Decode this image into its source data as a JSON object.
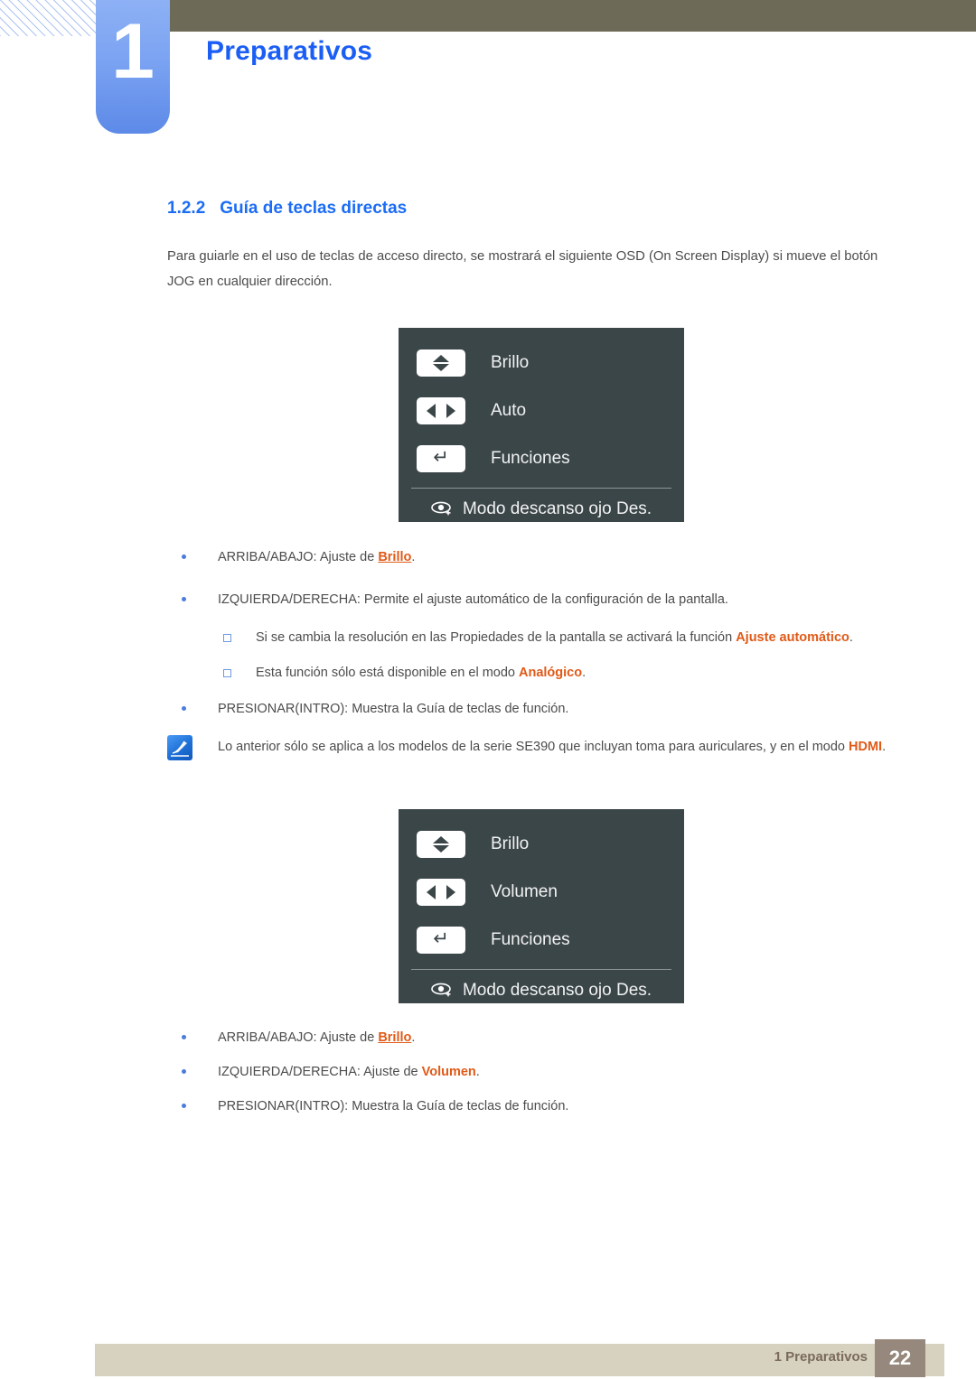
{
  "header": {
    "chapter_number": "1",
    "chapter_title": "Preparativos"
  },
  "section": {
    "number": "1.2.2",
    "title": "Guía de teclas directas",
    "intro": "Para guiarle en el uso de teclas de acceso directo, se mostrará el siguiente OSD (On Screen Display) si mueve el botón JOG en cualquier dirección."
  },
  "osd_first": {
    "rows": [
      {
        "icon": "up-down-arrow-icon",
        "label": "Brillo"
      },
      {
        "icon": "left-right-arrow-icon",
        "label": "Auto"
      },
      {
        "icon": "enter-arrow-icon",
        "label": "Funciones"
      }
    ],
    "footer_row": {
      "icon": "eye-icon",
      "label": "Modo descanso ojo Des."
    }
  },
  "osd_second": {
    "rows": [
      {
        "icon": "up-down-arrow-icon",
        "label": "Brillo"
      },
      {
        "icon": "left-right-arrow-icon",
        "label": "Volumen"
      },
      {
        "icon": "enter-arrow-icon",
        "label": "Funciones"
      }
    ],
    "footer_row": {
      "icon": "eye-icon",
      "label": "Modo descanso ojo Des."
    }
  },
  "list_first": {
    "item1_pre": "ARRIBA/ABAJO: Ajuste de ",
    "item1_hl": "Brillo",
    "item1_post": ".",
    "item2": "IZQUIERDA/DERECHA: Permite el ajuste automático de la configuración de la pantalla.",
    "sub1_pre": "Si se cambia la resolución en las Propiedades de la pantalla se activará la función ",
    "sub1_hl": "Ajuste automático",
    "sub1_post": ".",
    "sub2_pre": "Esta función sólo está disponible en el modo ",
    "sub2_hl": "Analógico",
    "sub2_post": ".",
    "item3": "PRESIONAR(INTRO): Muestra la Guía de teclas de función."
  },
  "note": {
    "icon": "note-pen-icon",
    "text_pre": "Lo anterior sólo se aplica a los modelos de la serie SE390 que incluyan toma para auriculares, y en el modo ",
    "text_hl": "HDMI",
    "text_post": "."
  },
  "list_second": {
    "item1_pre": "ARRIBA/ABAJO: Ajuste de ",
    "item1_hl": "Brillo",
    "item1_post": ".",
    "item2_pre": "IZQUIERDA/DERECHA: Ajuste de ",
    "item2_hl": "Volumen",
    "item2_post": ".",
    "item3": "PRESIONAR(INTRO): Muestra la Guía de teclas de función."
  },
  "footer": {
    "label": "1 Preparativos",
    "page_number": "22"
  },
  "colors": {
    "header_bar": "#6d6b57",
    "chapter_tab": "#7ba3f2",
    "title_blue": "#1b5ef5",
    "heading_blue": "#1b6cf5",
    "highlight_orange": "#e05a18",
    "osd_bg": "#3b4649",
    "footer_bar": "#d7d2c0",
    "footer_page_bg": "#96887c"
  }
}
